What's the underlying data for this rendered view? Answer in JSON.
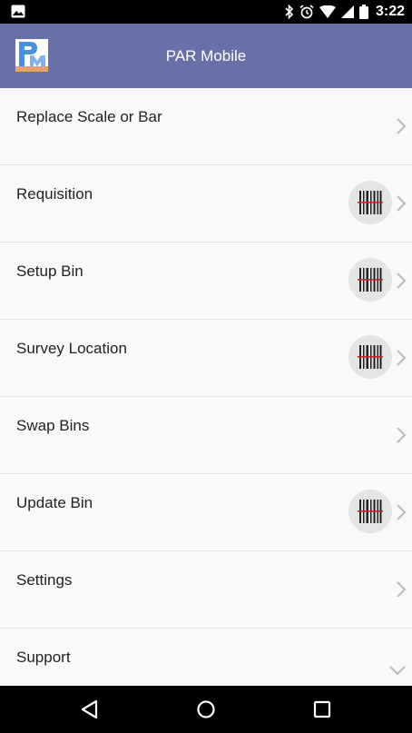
{
  "status_bar": {
    "time": "3:22",
    "icons": [
      "image-icon",
      "bluetooth-icon",
      "alarm-icon",
      "wifi-icon",
      "signal-icon",
      "battery-icon"
    ]
  },
  "app_bar": {
    "title": "PAR Mobile",
    "logo_icon": "par-logo-icon"
  },
  "menu": {
    "items": [
      {
        "label": "Replace Scale or Bar",
        "scan": false,
        "chevron": "right"
      },
      {
        "label": "Requisition",
        "scan": true,
        "chevron": "right"
      },
      {
        "label": "Setup Bin",
        "scan": true,
        "chevron": "right"
      },
      {
        "label": "Survey Location",
        "scan": true,
        "chevron": "right"
      },
      {
        "label": "Swap Bins",
        "scan": false,
        "chevron": "right"
      },
      {
        "label": "Update Bin",
        "scan": true,
        "chevron": "right"
      },
      {
        "label": "Settings",
        "scan": false,
        "chevron": "right"
      },
      {
        "label": "Support",
        "scan": false,
        "chevron": "down"
      }
    ]
  },
  "nav_bar": {
    "buttons": [
      "back-icon",
      "home-icon",
      "recents-icon"
    ]
  },
  "colors": {
    "app_bar": "#6870a8",
    "background": "#f9f9f9",
    "scan_circle": "#e4e4e4",
    "barcode_line": "#c62828"
  }
}
